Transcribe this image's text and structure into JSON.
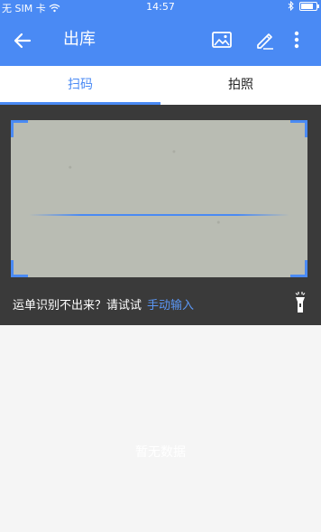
{
  "status_bar": {
    "carrier": "无 SIM 卡",
    "time": "14:57"
  },
  "app_bar": {
    "title": "出库",
    "back_icon": "arrow-left-icon",
    "actions": [
      "image-icon",
      "pencil-icon",
      "more-vert-icon"
    ]
  },
  "tabs": [
    {
      "label": "扫码",
      "active": true
    },
    {
      "label": "拍照",
      "active": false
    }
  ],
  "scanner": {
    "hint": "运单识别不出来？请试试",
    "manual_link": "手动输入"
  },
  "empty_state": {
    "text": "暂无数据"
  },
  "colors": {
    "primary": "#4a8af4",
    "camera_bg": "#3a3a3a",
    "page_bg": "#f5f5f5"
  }
}
